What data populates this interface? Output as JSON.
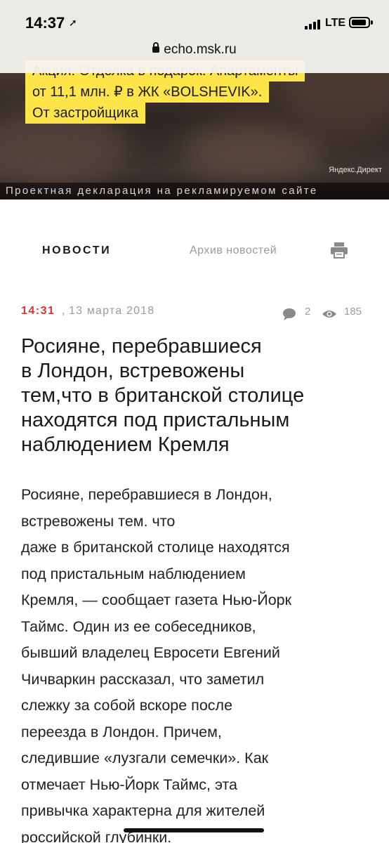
{
  "status_bar": {
    "time": "14:37",
    "network": "LTE"
  },
  "browser": {
    "url": "echo.msk.ru"
  },
  "ad": {
    "lines": [
      "Акция: Отделка в подарок. Апартаменты",
      "от 11,1 млн. ₽ в ЖК «BOLSHEVIK».",
      "От застройщика"
    ],
    "source": "Яндекс.Директ",
    "declaration": "Проектная декларация на рекламируемом сайте"
  },
  "nav": {
    "news_label": "НОВОСТИ",
    "archive_label": "Архив новостей"
  },
  "meta": {
    "time": "14:31",
    "date": "13 марта 2018",
    "comments": "2",
    "views": "185"
  },
  "article": {
    "headline_lines": [
      "Росияне, перебравшиеся",
      "в Лондон, встревожены",
      "тем,что в британской столице",
      "находятся под пристальным",
      "наблюдением Кремля"
    ],
    "body_lines": [
      "Росияне, перебравшиеся в Лондон,",
      "встревожены тем. что",
      "даже в британской столице находятся",
      "под пристальным наблюдением",
      "Кремля, — сообщает газета Нью-Йорк",
      "Таймс. Один из ее собеседников,",
      "бывший владелец Евросети Евгений",
      "Чичваркин рассказал, что заметил",
      "слежку за собой вскоре после",
      "переезда в Лондон. Причем,",
      "следившие «лузгали семечки». Как",
      "отмечает Нью-Йорк Таймс, эта",
      "привычка характерна для жителей",
      "российской глубинки."
    ]
  },
  "colors": {
    "accent_red": "#e03030",
    "ad_yellow": "#ffe54a",
    "muted_gray": "#9a9a9a"
  }
}
